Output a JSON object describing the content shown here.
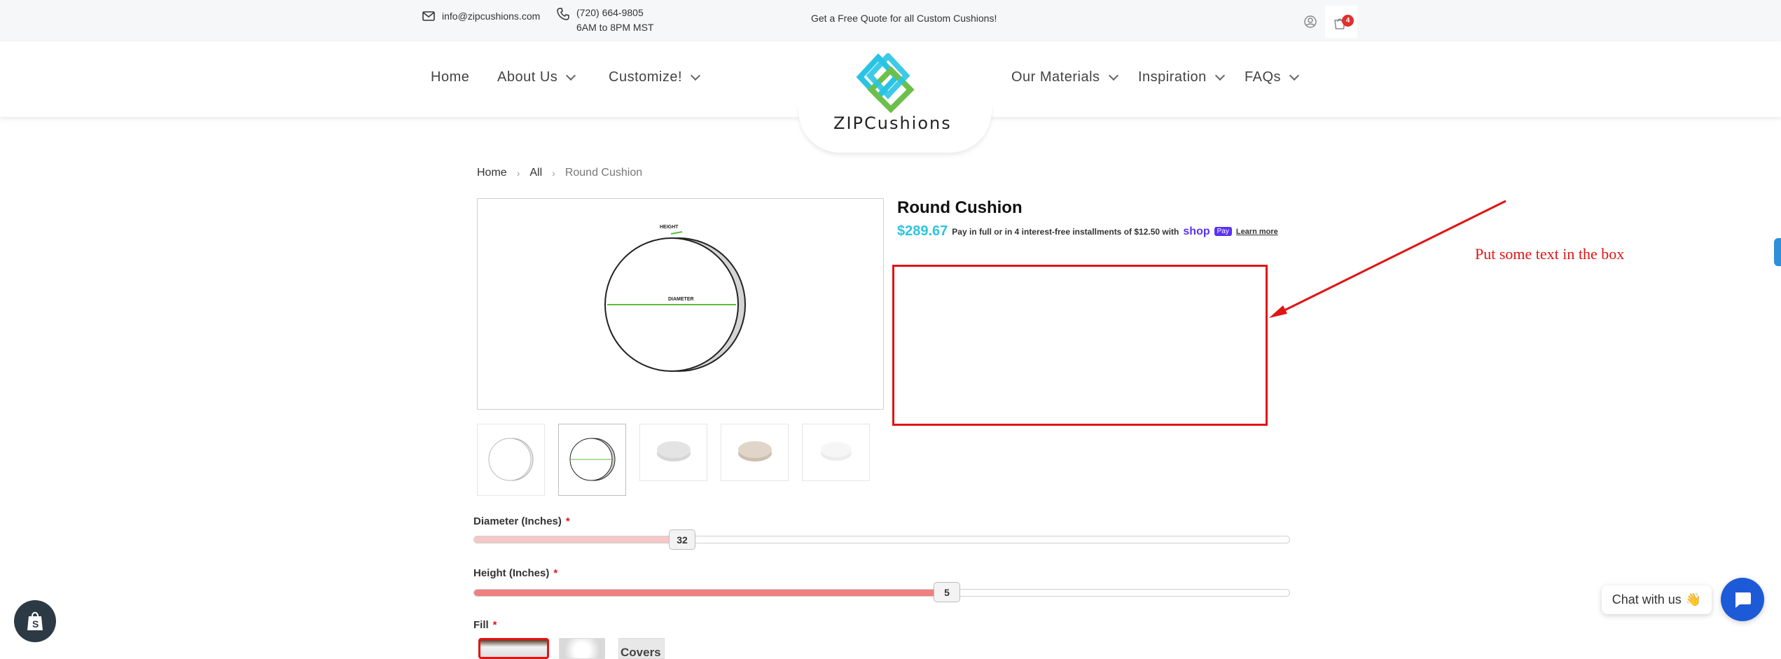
{
  "topbar": {
    "email": "info@zipcushions.com",
    "phone": "(720) 664-9805",
    "hours": "6AM to 8PM MST",
    "promo": "Get a Free Quote for all Custom Cushions!",
    "cart_count": "4"
  },
  "nav": {
    "home": "Home",
    "about": "About Us",
    "customize": "Customize!",
    "materials": "Our Materials",
    "inspiration": "Inspiration",
    "faqs": "FAQs"
  },
  "logo": {
    "text": "ZIPCushions"
  },
  "breadcrumb": {
    "home": "Home",
    "all": "All",
    "current": "Round Cushion"
  },
  "product": {
    "title": "Round Cushion",
    "price": "$289.67",
    "installments": "Pay in full or in 4 interest-free installments of $12.50 with",
    "shop_label": "shop",
    "pay_label": "Pay",
    "learn_more": "Learn more",
    "diagram": {
      "height_label": "HEIGHT",
      "diameter_label": "DIAMETER"
    }
  },
  "annotation": {
    "text": "Put some text in the box",
    "color": "#e11414"
  },
  "options": {
    "diameter": {
      "label": "Diameter (Inches)",
      "required": "*",
      "value": "32",
      "fraction": 0.25
    },
    "height": {
      "label": "Height (Inches)",
      "required": "*",
      "value": "5",
      "fraction": 0.58
    },
    "fill": {
      "label": "Fill",
      "required": "*",
      "covers_label": "Covers"
    }
  },
  "chat": {
    "label": "Chat with us",
    "emoji": "👋"
  },
  "colors": {
    "accent_price": "#2fc4dc",
    "shop_purple": "#5a31f4",
    "chat_blue": "#1c5ad8",
    "logo_blue": "#29c4e4",
    "logo_green": "#6cc04a"
  }
}
